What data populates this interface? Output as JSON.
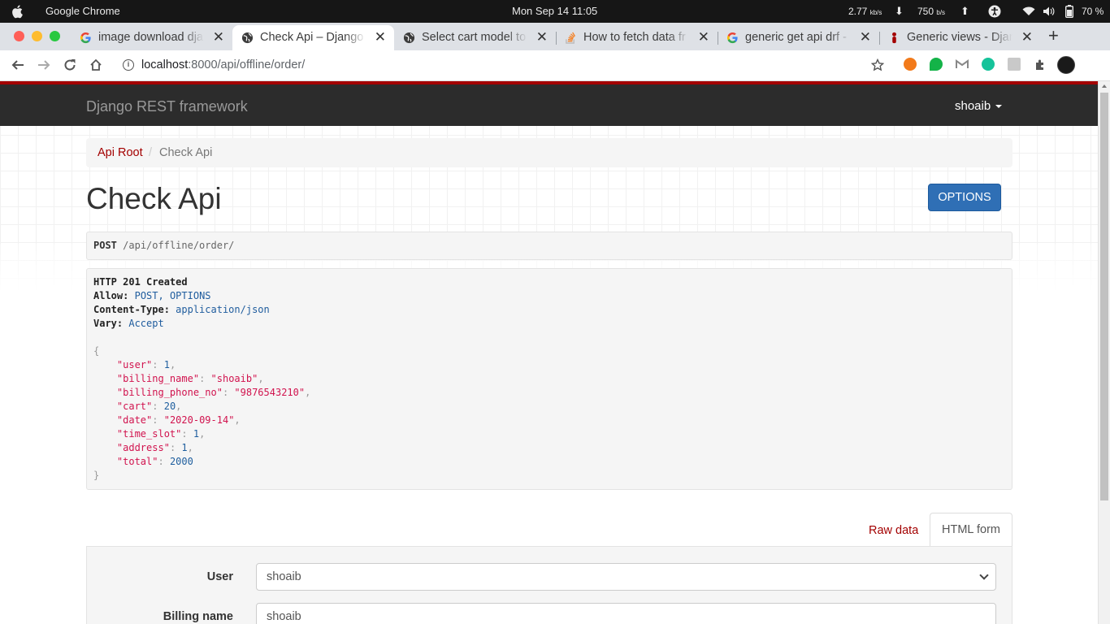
{
  "os": {
    "app_name": "Google Chrome",
    "clock": "Mon Sep 14  11:05",
    "net_down_value": "2.77",
    "net_down_unit": "kb/s",
    "net_up_value": "750",
    "net_up_unit": "b/s",
    "battery": "70 %"
  },
  "tabs": [
    {
      "title": "image download dja",
      "favicon": "google-icon",
      "active": false
    },
    {
      "title": "Check Api – Django",
      "favicon": "globe-icon",
      "active": true
    },
    {
      "title": "Select cart model to",
      "favicon": "globe-icon",
      "active": false
    },
    {
      "title": "How to fetch data fr",
      "favicon": "stackoverflow-icon",
      "active": false
    },
    {
      "title": "generic get api drf -",
      "favicon": "google-icon",
      "active": false
    },
    {
      "title": "Generic views - Djan",
      "favicon": "drf-icon",
      "active": false
    }
  ],
  "address": {
    "host": "localhost",
    "path": ":8000/api/offline/order/"
  },
  "drf": {
    "brand": "Django REST framework",
    "user": "shoaib",
    "breadcrumb_root": "Api Root",
    "breadcrumb_current": "Check Api",
    "page_title": "Check Api",
    "options_button": "OPTIONS",
    "request": {
      "method": "POST",
      "path": "/api/offline/order/"
    },
    "response": {
      "status": "HTTP 201 Created",
      "headers": [
        {
          "name": "Allow:",
          "value": "POST, OPTIONS"
        },
        {
          "name": "Content-Type:",
          "value": "application/json"
        },
        {
          "name": "Vary:",
          "value": "Accept"
        }
      ],
      "body": [
        {
          "key": "\"user\"",
          "value": "1",
          "kind": "num"
        },
        {
          "key": "\"billing_name\"",
          "value": "\"shoaib\"",
          "kind": "str"
        },
        {
          "key": "\"billing_phone_no\"",
          "value": "\"9876543210\"",
          "kind": "str"
        },
        {
          "key": "\"cart\"",
          "value": "20",
          "kind": "num"
        },
        {
          "key": "\"date\"",
          "value": "\"2020-09-14\"",
          "kind": "str"
        },
        {
          "key": "\"time_slot\"",
          "value": "1",
          "kind": "num"
        },
        {
          "key": "\"address\"",
          "value": "1",
          "kind": "num"
        },
        {
          "key": "\"total\"",
          "value": "2000",
          "kind": "num"
        }
      ]
    },
    "form_tabs": {
      "raw": "Raw data",
      "html": "HTML form"
    },
    "form": {
      "user_label": "User",
      "user_value": "shoaib",
      "billing_name_label": "Billing name",
      "billing_name_value": "shoaib"
    }
  },
  "colors": {
    "drf_red": "#a30000",
    "options_blue": "#2f6fb5",
    "json_key": "#d1134e",
    "json_num": "#1e5e9e"
  }
}
